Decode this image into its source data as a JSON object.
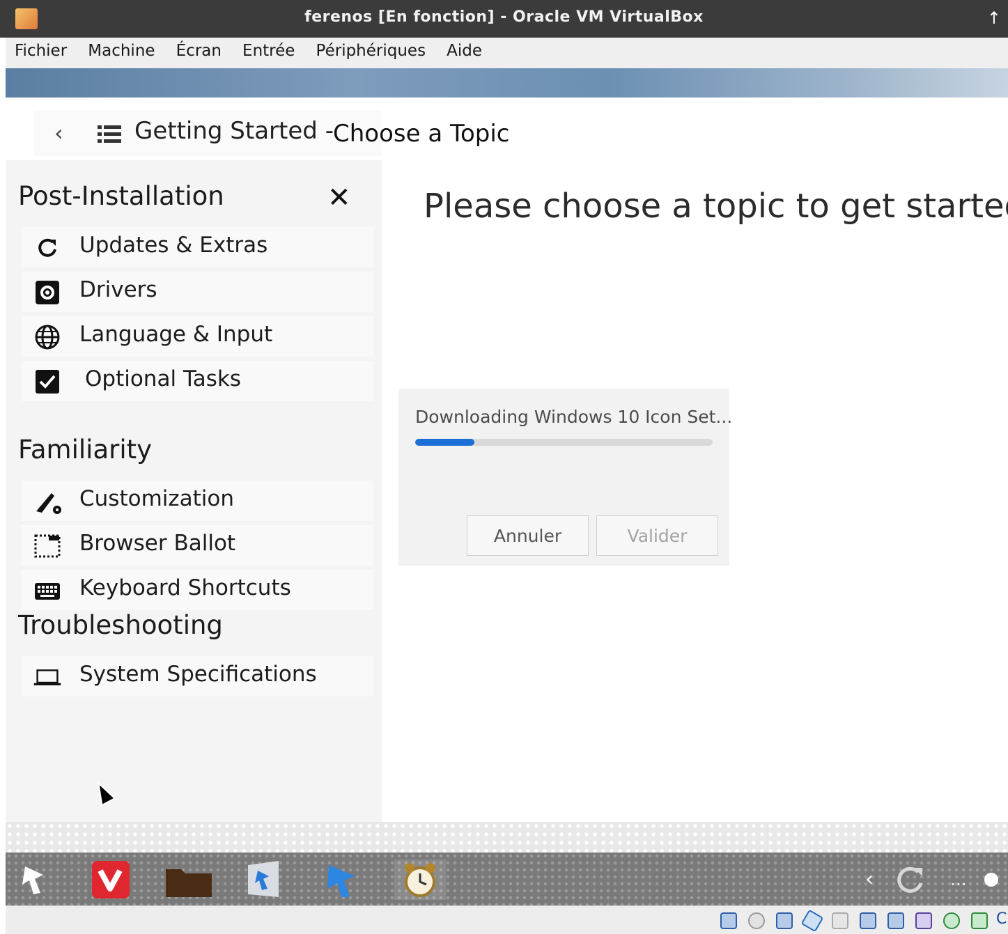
{
  "window": {
    "title": "ferenos [En fonction] - Oracle VM VirtualBox"
  },
  "menubar": {
    "items": [
      "Fichier",
      "Machine",
      "Écran",
      "Entrée",
      "Périphériques",
      "Aide"
    ]
  },
  "header": {
    "crumb_root": "Getting Started",
    "crumb_separator": "-",
    "crumb_page": "Choose a Topic"
  },
  "sidebar": {
    "sections": [
      {
        "title": "Post-Installation",
        "items": [
          {
            "label": "Updates & Extras",
            "icon": "refresh-icon"
          },
          {
            "label": "Drivers",
            "icon": "driver-gear-icon"
          },
          {
            "label": "Language & Input",
            "icon": "globe-icon"
          },
          {
            "label": "Optional Tasks",
            "icon": "checkbox-icon"
          }
        ]
      },
      {
        "title": "Familiarity",
        "items": [
          {
            "label": "Customization",
            "icon": "brush-gear-icon"
          },
          {
            "label": "Browser Ballot",
            "icon": "browser-window-icon"
          },
          {
            "label": "Keyboard Shortcuts",
            "icon": "keyboard-icon"
          }
        ]
      },
      {
        "title": "Troubleshooting",
        "items": [
          {
            "label": "System Specifications",
            "icon": "laptop-icon"
          }
        ]
      }
    ]
  },
  "main": {
    "heading": "Please choose a topic to get started."
  },
  "dialog": {
    "message": "Downloading Windows 10 Icon Set...",
    "progress": 0.2,
    "cancel_label": "Annuler",
    "ok_label": "Valider",
    "progress_color": "#1c6fd6"
  },
  "taskbar": {
    "items": [
      "start-icon",
      "vivaldi-icon",
      "folder-icon",
      "store-icon",
      "feren-icon",
      "alarm-clock-icon"
    ],
    "tray": [
      "chevron-left-icon",
      "refresh-icon",
      "more-icon",
      "dot-icon"
    ]
  },
  "statusbar": {
    "icons": [
      "hard-disk-icon",
      "optical-drive-icon",
      "network-icon",
      "usb-icon",
      "shared-folder-icon",
      "display-icon",
      "recording-icon",
      "cpu-icon",
      "mouse-integration-icon",
      "guest-additions-icon"
    ],
    "host_key_glyph": "C"
  }
}
